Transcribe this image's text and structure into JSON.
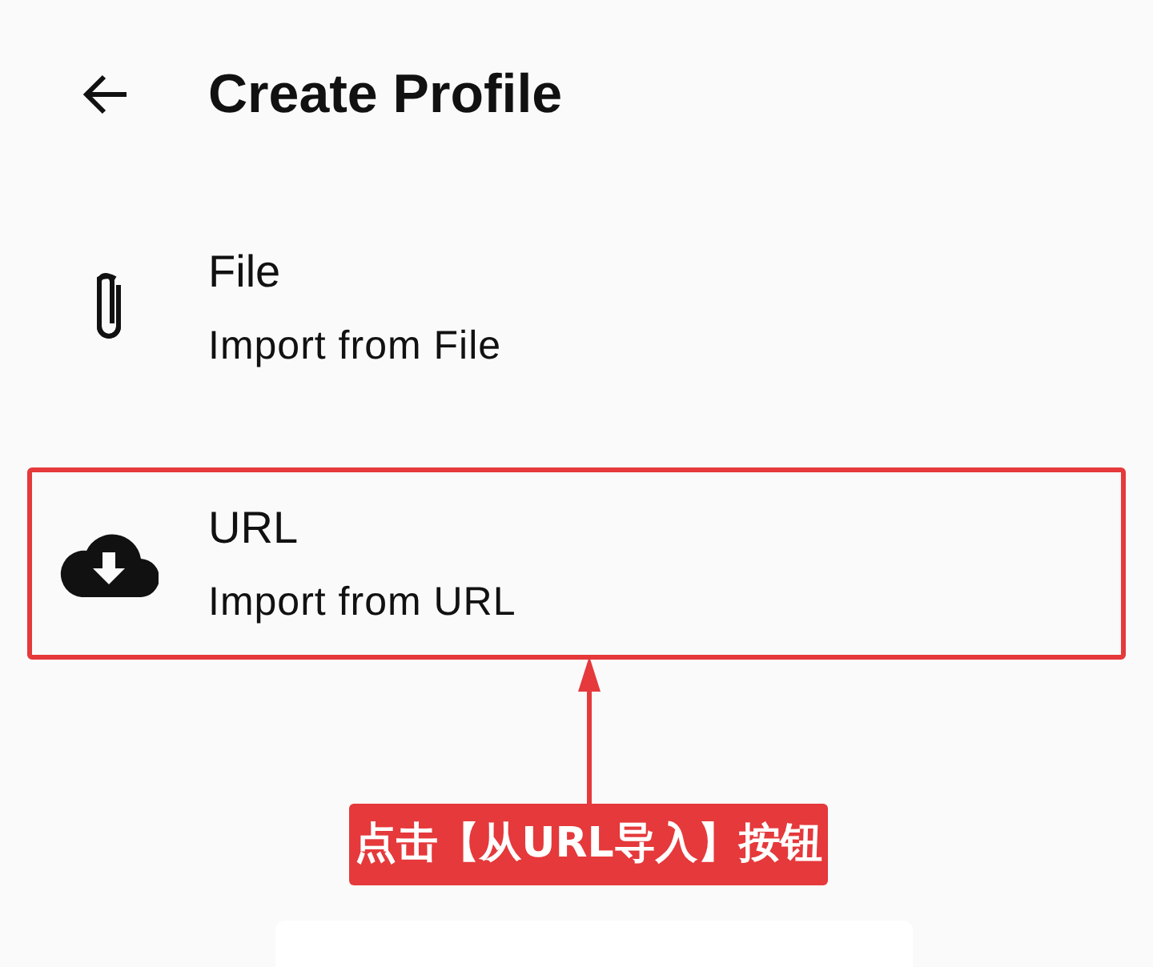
{
  "header": {
    "title": "Create Profile"
  },
  "items": [
    {
      "kind": "file",
      "title": "File",
      "subtitle": "Import from File",
      "highlighted": false
    },
    {
      "kind": "url",
      "title": "URL",
      "subtitle": "Import from URL",
      "highlighted": true
    }
  ],
  "annotation": {
    "label": "点击【从URL导入】按钮"
  }
}
